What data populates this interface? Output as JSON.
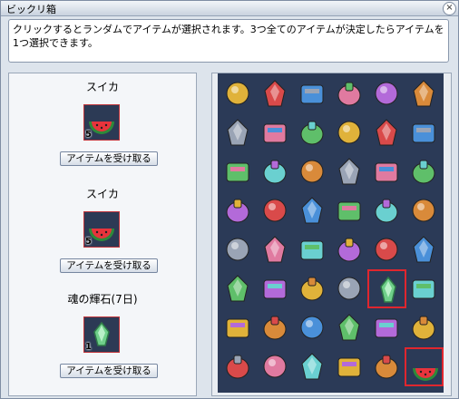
{
  "window": {
    "title": "ビックリ箱"
  },
  "message": "クリックするとランダムでアイテムが選択されます。3つ全てのアイテムが決定したらアイテムを1つ選択できます。",
  "slots": [
    {
      "name": "スイカ",
      "count": "5",
      "icon": "watermelon-icon",
      "button": "アイテムを受け取る"
    },
    {
      "name": "スイカ",
      "count": "5",
      "icon": "watermelon-icon",
      "button": "アイテムを受け取る"
    },
    {
      "name": "魂の輝石(7日)",
      "count": "1",
      "icon": "soul-stone-icon",
      "button": "アイテムを受け取る"
    }
  ],
  "grid": {
    "rows": [
      [
        "dart-icon",
        "angel-wings-icon",
        "pot-icon",
        "ticket-icon",
        "sandwich-icon",
        "potion-icon"
      ],
      [
        "blue-cloth-icon",
        "bowling-pin-icon",
        "winged-ticket-icon",
        "red-crystal-icon",
        "blue-crystal-icon",
        "green-crystal-icon"
      ],
      [
        "orange-crystal-icon",
        "coupon-icon",
        "blue-star-icon",
        "perfume-icon",
        "calendar-icon",
        "purple-crystal-icon"
      ],
      [
        "stone-egg-icon",
        "card-icon",
        "scroll-icon",
        "doll-icon",
        "medal-icon",
        "hammer-icon"
      ],
      [
        "green-gem-icon",
        "teal-crystal-icon",
        "red-egg-icon",
        "pink-potion-icon",
        "rose-potion-icon",
        "backpack-icon"
      ],
      [
        "yellow-capsule-icon",
        "winged-scroll-icon",
        "pink-cake-icon",
        "blue-capsule-icon",
        "soul-stone-icon",
        "winged-tag-icon"
      ],
      [
        "gold-ring-icon",
        "crest-badge-icon",
        "medal-i-icon",
        "red-badge-icon",
        "gold-coin-icon",
        "black-badge-icon"
      ],
      [
        "winged-crest-icon",
        "capsule-icon",
        "scroll-pack-icon",
        "bowl-icon",
        "gold-emblem-icon",
        "watermelon-icon"
      ]
    ],
    "selected": [
      "5-4",
      "7-5"
    ]
  }
}
